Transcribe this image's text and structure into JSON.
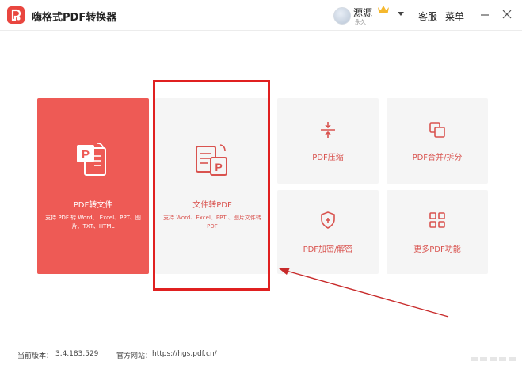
{
  "app": {
    "title": "嗨格式PDF转换器"
  },
  "user": {
    "name": "源源",
    "sub": "永久"
  },
  "header": {
    "service_label": "客服",
    "menu_label": "菜单"
  },
  "cards": {
    "pdf_to_file": {
      "title": "PDF转文件",
      "desc": "支持 PDF 转 Word、 Excel、PPT、图片、TXT、HTML"
    },
    "file_to_pdf": {
      "title": "文件转PDF",
      "desc": "支持 Word、Excel、PPT 、图片文件转 PDF"
    },
    "compress": {
      "title": "PDF压缩"
    },
    "merge_split": {
      "title": "PDF合并/拆分"
    },
    "encrypt": {
      "title": "PDF加密/解密"
    },
    "more": {
      "title": "更多PDF功能"
    }
  },
  "footer": {
    "version_label": "当前版本：",
    "version": "3.4.183.529",
    "website_label": "官方网站：",
    "website": "https://hgs.pdf.cn/"
  },
  "colors": {
    "accent": "#ee5a55",
    "highlight": "#e02020",
    "card_bg": "#f5f5f5"
  }
}
